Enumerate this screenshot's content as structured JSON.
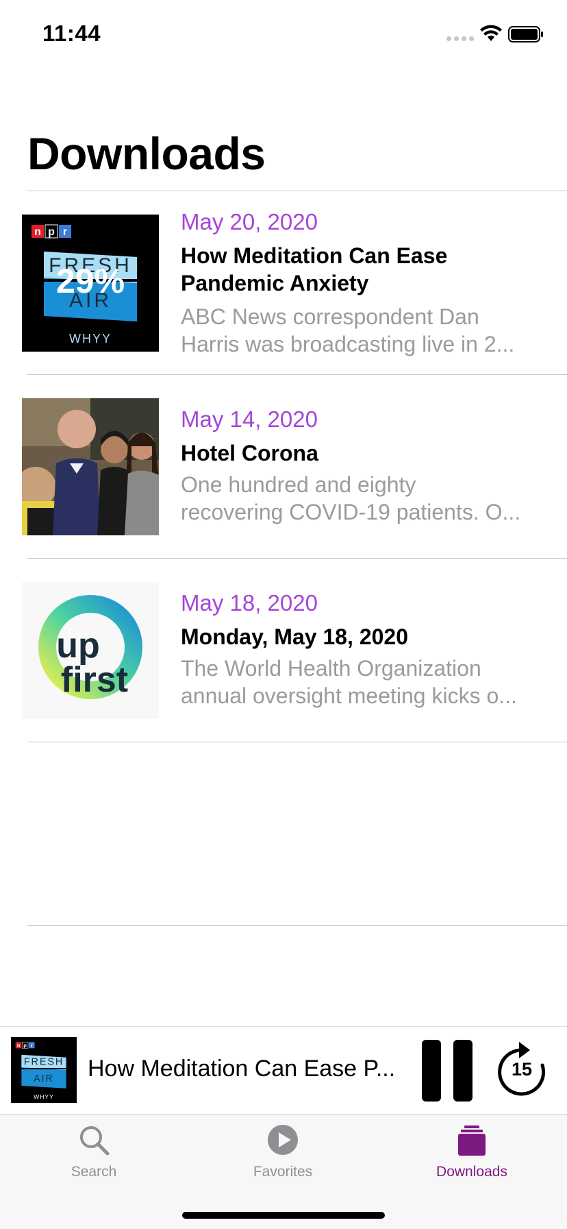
{
  "status_bar": {
    "time": "11:44"
  },
  "page": {
    "title": "Downloads"
  },
  "episodes": [
    {
      "date": "May 20, 2020",
      "title": "How Meditation Can Ease Pandemic Anxiety",
      "description_line1": "ABC News correspondent Dan",
      "description_line2": "Harris was broadcasting live in 2...",
      "artwork": {
        "type": "fresh-air",
        "npr_letters": [
          "n",
          "p",
          "r"
        ],
        "word_top": "FRESH",
        "word_bottom": "AIR",
        "station": "WHYY",
        "download_progress": "29%"
      }
    },
    {
      "date": "May 14, 2020",
      "title": "Hotel Corona",
      "description_line1": "One hundred and eighty",
      "description_line2": "recovering COVID-19 patients. O...",
      "artwork": {
        "type": "photo"
      }
    },
    {
      "date": "May 18, 2020",
      "title": "Monday, May 18, 2020",
      "description_line1": "The World Health Organization",
      "description_line2": "annual oversight meeting kicks o...",
      "artwork": {
        "type": "up-first",
        "word_top": "up",
        "word_bottom": "first"
      }
    }
  ],
  "mini_player": {
    "title": "How Meditation Can Ease P...",
    "artwork": {
      "npr_letters": [
        "n",
        "p",
        "r"
      ],
      "word_top": "FRESH",
      "word_bottom": "AIR",
      "station": "WHYY"
    },
    "skip_seconds": "15"
  },
  "tabs": [
    {
      "label": "Search",
      "icon": "search-icon",
      "active": false
    },
    {
      "label": "Favorites",
      "icon": "play-circle-icon",
      "active": false
    },
    {
      "label": "Downloads",
      "icon": "stack-icon",
      "active": true
    }
  ],
  "colors": {
    "accent_purple": "#a546d6",
    "active_tab": "#7c1a82",
    "fresh_air_blue": "#1a8fd6",
    "npr_red": "#e01f26",
    "npr_blue": "#3d7bd6",
    "up_first_text": "#1a2e3a"
  }
}
